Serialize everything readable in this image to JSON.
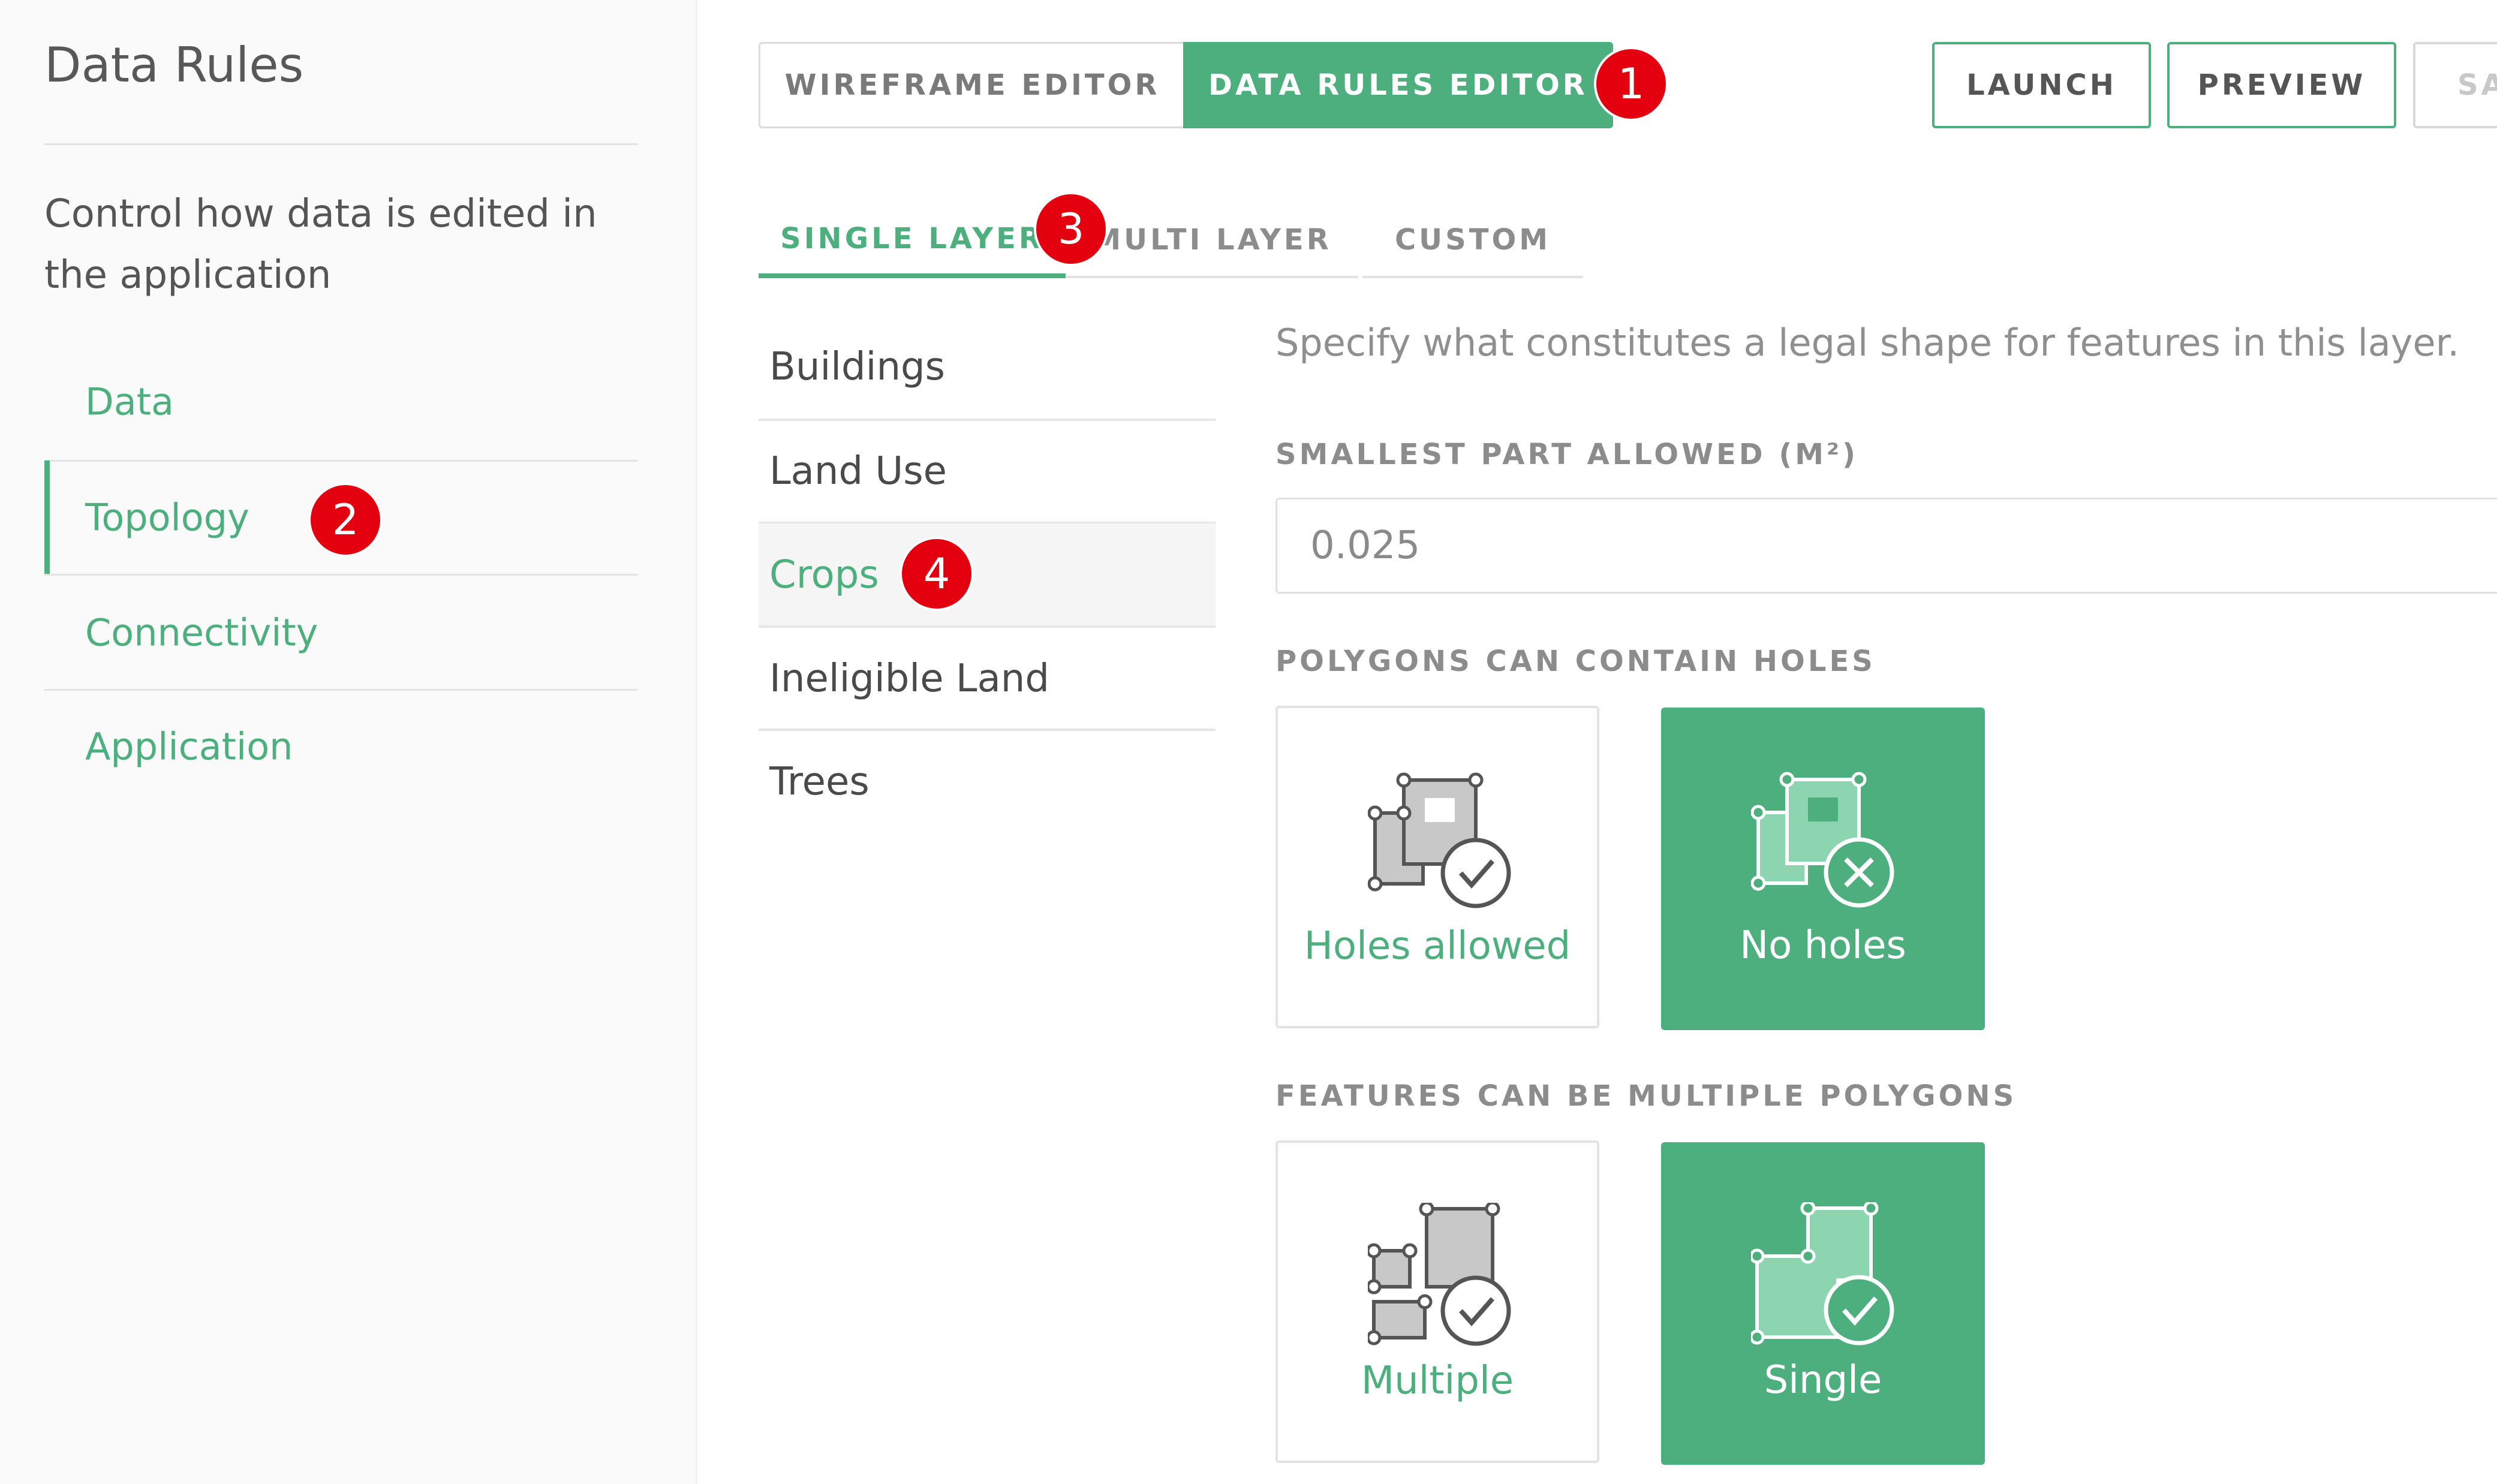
{
  "sidebar": {
    "title": "Data Rules",
    "description": "Control how data is edited in the application",
    "items": [
      {
        "label": "Data"
      },
      {
        "label": "Topology"
      },
      {
        "label": "Connectivity"
      },
      {
        "label": "Application"
      }
    ]
  },
  "editor_toggle": {
    "wireframe": "WIREFRAME EDITOR",
    "data_rules": "DATA RULES EDITOR"
  },
  "actions": {
    "launch": "LAUNCH",
    "preview": "PREVIEW",
    "save_partial": "SA"
  },
  "layer_tabs": {
    "single": "SINGLE LAYER",
    "multi": "MULTI LAYER",
    "custom": "CUSTOM"
  },
  "layers": [
    {
      "label": "Buildings"
    },
    {
      "label": "Land Use"
    },
    {
      "label": "Crops"
    },
    {
      "label": "Ineligible Land"
    },
    {
      "label": "Trees"
    }
  ],
  "form": {
    "description": "Specify what constitutes a legal shape for features in this layer.",
    "smallest_part_label": "SMALLEST PART ALLOWED (M²)",
    "smallest_part_value": "0.025",
    "holes_label": "POLYGONS CAN CONTAIN HOLES",
    "holes_allowed": "Holes allowed",
    "no_holes": "No holes",
    "multi_label": "FEATURES CAN BE MULTIPLE POLYGONS",
    "multiple": "Multiple",
    "single": "Single"
  },
  "badges": {
    "b1": "1",
    "b2": "2",
    "b3": "3",
    "b4": "4"
  },
  "colors": {
    "accent": "#4caf7d",
    "badge": "#e3000f"
  }
}
